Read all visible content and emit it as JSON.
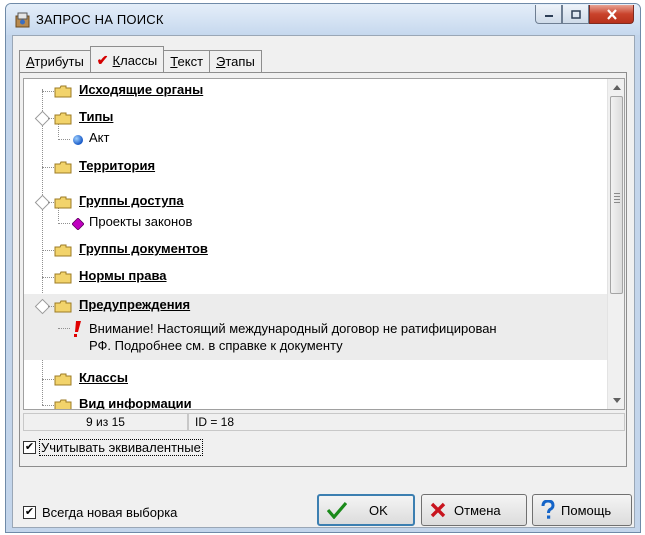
{
  "window": {
    "title": "ЗАПРОС НА ПОИСК"
  },
  "tabs": [
    {
      "label": "Атрибуты",
      "access": "А",
      "rest": "трибуты"
    },
    {
      "label": "Классы",
      "access": "К",
      "rest": "лассы"
    },
    {
      "label": "Текст",
      "access": "Т",
      "rest": "екст"
    },
    {
      "label": "Этапы",
      "access": "Э",
      "rest": "тапы"
    }
  ],
  "tree": [
    {
      "label": "Исходящие органы",
      "kind": "folder",
      "expandable": false
    },
    {
      "label": "Типы",
      "kind": "folder",
      "expandable": true
    },
    {
      "label": "Акт",
      "kind": "leaf",
      "icon": "blue-ball-icon"
    },
    {
      "label": "Территория",
      "kind": "folder",
      "expandable": false
    },
    {
      "label": "Группы доступа",
      "kind": "folder",
      "expandable": true
    },
    {
      "label": "Проекты законов",
      "kind": "leaf",
      "icon": "magenta-diamond-icon"
    },
    {
      "label": "Группы документов",
      "kind": "folder",
      "expandable": false
    },
    {
      "label": "Нормы права",
      "kind": "folder",
      "expandable": false
    },
    {
      "label": "Предупреждения",
      "kind": "folder",
      "expandable": true,
      "selected": true
    },
    {
      "label_line1": "Внимание! Настоящий международный договор не ратифицирован",
      "label_line2": "РФ. Подробнее см. в справке к документу",
      "kind": "warning",
      "icon": "exclamation-icon"
    },
    {
      "label": "Классы",
      "kind": "folder",
      "expandable": false
    },
    {
      "label": "Вид информации",
      "kind": "folder",
      "expandable": false
    }
  ],
  "status": {
    "position": "9 из 15",
    "id": "ID = 18"
  },
  "options": {
    "equivalents_label": "Учитывать эквивалентные",
    "equivalents_checked": true,
    "always_new_label": "Всегда новая выборка",
    "always_new_checked": true
  },
  "buttons": {
    "ok": "OK",
    "cancel": "Отмена",
    "help": "Помощь"
  },
  "colors": {
    "accent": "#3c7fb1",
    "close": "#c9432c",
    "folder": "#f2d36b",
    "check": "#d40000"
  }
}
